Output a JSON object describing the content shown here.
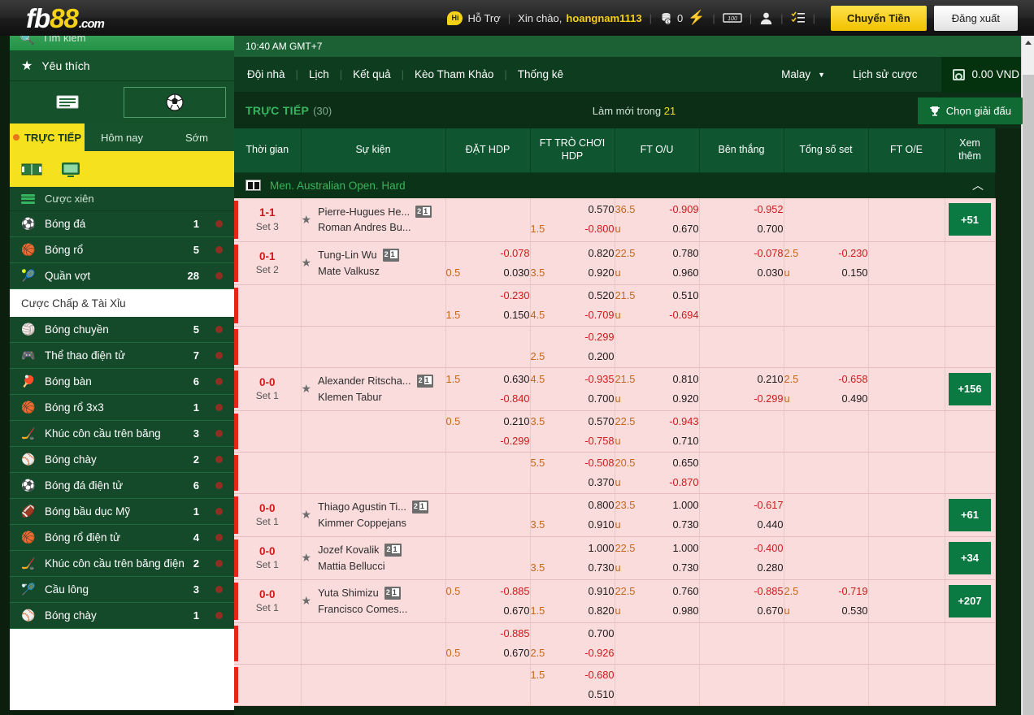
{
  "header": {
    "logo_fb": "fb",
    "logo_88": "88",
    "logo_dotcom": ".com",
    "hi_label": "Hi",
    "support_label": "Hỗ Trợ",
    "greeting": "Xin chào,",
    "username": "hoangnam1113",
    "coin_count": "0",
    "transfer_button": "Chuyển Tiền",
    "logout_button": "Đăng xuất",
    "icons": [
      "chat-bubble-icon",
      "coin-stack-icon",
      "lightning-icon",
      "cash-icon",
      "user-icon",
      "checklist-icon"
    ]
  },
  "sidebar": {
    "search_placeholder": "Tìm kiếm",
    "favourites_label": "Yêu thích",
    "mode_icons": [
      "ticket-icon",
      "football-icon"
    ],
    "tabs": [
      {
        "label": "TRỰC TIẾP",
        "active": true
      },
      {
        "label": "Hôm nay",
        "active": false
      },
      {
        "label": "Sớm",
        "active": false
      }
    ],
    "view_icons": [
      "field-view-icon",
      "tv-view-icon"
    ],
    "parlay_label": "Cược xiên",
    "sports": [
      {
        "icon": "soccer-icon",
        "name": "Bóng đá",
        "count": "1"
      },
      {
        "icon": "basketball-icon",
        "name": "Bóng rổ",
        "count": "5"
      },
      {
        "icon": "tennis-icon",
        "name": "Quần vợt",
        "count": "28"
      }
    ],
    "submenu_label": "Cược Chấp & Tài Xỉu",
    "sports2": [
      {
        "icon": "volleyball-icon",
        "name": "Bóng chuyền",
        "count": "5"
      },
      {
        "icon": "gamepad-icon",
        "name": "Thể thao điện tử",
        "count": "7"
      },
      {
        "icon": "pingpong-icon",
        "name": "Bóng bàn",
        "count": "6"
      },
      {
        "icon": "basketball3x3-icon",
        "name": "Bóng rổ 3x3",
        "count": "1"
      },
      {
        "icon": "hockey-icon",
        "name": "Khúc côn cầu trên băng",
        "count": "3"
      },
      {
        "icon": "baseball-icon",
        "name": "Bóng chày",
        "count": "2"
      },
      {
        "icon": "esoccer-icon",
        "name": "Bóng đá điện tử",
        "count": "6"
      },
      {
        "icon": "football-us-icon",
        "name": "Bóng bầu dục Mỹ",
        "count": "1"
      },
      {
        "icon": "ebasketball-icon",
        "name": "Bóng rổ điện tử",
        "count": "4"
      },
      {
        "icon": "ehockey-icon",
        "name": "Khúc côn cầu trên băng điện tử",
        "count": "2"
      },
      {
        "icon": "badminton-icon",
        "name": "Cầu lông",
        "count": "3"
      },
      {
        "icon": "ebaseball-icon",
        "name": "Bóng chày",
        "count": "1"
      }
    ]
  },
  "main": {
    "clock": "10:40 AM GMT+7",
    "nav": [
      "Đội nhà",
      "Lịch",
      "Kết quả",
      "Kèo Tham Khảo",
      "Thống kê"
    ],
    "odds_format": "Malay",
    "bet_history": "Lịch sử cược",
    "balance": "0.00 VND",
    "live_title": "TRỰC TIẾP",
    "live_count": "(30)",
    "refresh_prefix": "Làm mới trong",
    "refresh_seconds": "21",
    "league_button": "Chọn giải đấu",
    "columns": [
      "Thời gian",
      "Sự kiện",
      "ĐẶT HDP",
      "FT TRÒ CHƠI HDP",
      "FT O/U",
      "Bên thắng",
      "Tổng số set",
      "FT O/E",
      "Xem thêm"
    ],
    "league": "Men. Australian Open. Hard",
    "rows": [
      {
        "score": "1-1",
        "set": "Set 3",
        "team1": "Pierre-Hugues He...",
        "team2": "Roman Andres Bu...",
        "badge": "21",
        "hdp": {
          "l1h": "",
          "l1v": "",
          "l1n": false,
          "l2h": "",
          "l2v": "",
          "l2n": false
        },
        "ftg": {
          "l1h": "",
          "l1v": "0.570",
          "l1n": false,
          "l2h": "1.5",
          "l2v": "-0.800",
          "l2n": true
        },
        "ou": {
          "l1h": "36.5",
          "l1v": "-0.909",
          "l1n": true,
          "l2h": "u",
          "l2v": "0.670",
          "l2n": false
        },
        "win": {
          "l1h": "",
          "l1v": "-0.952",
          "l1n": true,
          "l2h": "",
          "l2v": "0.700",
          "l2n": false
        },
        "sets": {
          "l1h": "",
          "l1v": "",
          "l1n": false,
          "l2h": "",
          "l2v": "",
          "l2n": false
        },
        "oe": {
          "l1h": "",
          "l1v": "",
          "l1n": false,
          "l2h": "",
          "l2v": "",
          "l2n": false
        },
        "more": "+51"
      },
      {
        "score": "0-1",
        "set": "Set 2",
        "team1": "Tung-Lin Wu",
        "team2": "Mate Valkusz",
        "badge": "21",
        "hdp": {
          "l1h": "",
          "l1v": "-0.078",
          "l1n": true,
          "l2h": "0.5",
          "l2v": "0.030",
          "l2n": false
        },
        "ftg": {
          "l1h": "",
          "l1v": "0.820",
          "l1n": false,
          "l2h": "3.5",
          "l2v": "0.920",
          "l2n": false
        },
        "ou": {
          "l1h": "22.5",
          "l1v": "0.780",
          "l1n": false,
          "l2h": "u",
          "l2v": "0.960",
          "l2n": false
        },
        "win": {
          "l1h": "",
          "l1v": "-0.078",
          "l1n": true,
          "l2h": "",
          "l2v": "0.030",
          "l2n": false
        },
        "sets": {
          "l1h": "2.5",
          "l1v": "-0.230",
          "l1n": true,
          "l2h": "u",
          "l2v": "0.150",
          "l2n": false
        },
        "oe": {
          "l1h": "",
          "l1v": "",
          "l1n": false,
          "l2h": "",
          "l2v": "",
          "l2n": false
        },
        "more": ""
      },
      {
        "score": "",
        "set": "",
        "team1": "",
        "team2": "",
        "badge": "",
        "hdp": {
          "l1h": "",
          "l1v": "-0.230",
          "l1n": true,
          "l2h": "1.5",
          "l2v": "0.150",
          "l2n": false
        },
        "ftg": {
          "l1h": "",
          "l1v": "0.520",
          "l1n": false,
          "l2h": "4.5",
          "l2v": "-0.709",
          "l2n": true
        },
        "ou": {
          "l1h": "21.5",
          "l1v": "0.510",
          "l1n": false,
          "l2h": "u",
          "l2v": "-0.694",
          "l2n": true
        },
        "win": {
          "l1h": "",
          "l1v": "",
          "l1n": false,
          "l2h": "",
          "l2v": "",
          "l2n": false
        },
        "sets": {
          "l1h": "",
          "l1v": "",
          "l1n": false,
          "l2h": "",
          "l2v": "",
          "l2n": false
        },
        "oe": {
          "l1h": "",
          "l1v": "",
          "l1n": false,
          "l2h": "",
          "l2v": "",
          "l2n": false
        },
        "more": ""
      },
      {
        "score": "",
        "set": "",
        "team1": "",
        "team2": "",
        "badge": "",
        "hdp": {
          "l1h": "",
          "l1v": "",
          "l1n": false,
          "l2h": "",
          "l2v": "",
          "l2n": false
        },
        "ftg": {
          "l1h": "",
          "l1v": "-0.299",
          "l1n": true,
          "l2h": "2.5",
          "l2v": "0.200",
          "l2n": false
        },
        "ou": {
          "l1h": "",
          "l1v": "",
          "l1n": false,
          "l2h": "",
          "l2v": "",
          "l2n": false
        },
        "win": {
          "l1h": "",
          "l1v": "",
          "l1n": false,
          "l2h": "",
          "l2v": "",
          "l2n": false
        },
        "sets": {
          "l1h": "",
          "l1v": "",
          "l1n": false,
          "l2h": "",
          "l2v": "",
          "l2n": false
        },
        "oe": {
          "l1h": "",
          "l1v": "",
          "l1n": false,
          "l2h": "",
          "l2v": "",
          "l2n": false
        },
        "more": ""
      },
      {
        "score": "0-0",
        "set": "Set 1",
        "team1": "Alexander Ritscha...",
        "team2": "Klemen Tabur",
        "badge": "21",
        "hdp": {
          "l1h": "1.5",
          "l1v": "0.630",
          "l1n": false,
          "l2h": "",
          "l2v": "-0.840",
          "l2n": true
        },
        "ftg": {
          "l1h": "4.5",
          "l1v": "-0.935",
          "l1n": true,
          "l2h": "",
          "l2v": "0.700",
          "l2n": false
        },
        "ou": {
          "l1h": "21.5",
          "l1v": "0.810",
          "l1n": false,
          "l2h": "u",
          "l2v": "0.920",
          "l2n": false
        },
        "win": {
          "l1h": "",
          "l1v": "0.210",
          "l1n": false,
          "l2h": "",
          "l2v": "-0.299",
          "l2n": true
        },
        "sets": {
          "l1h": "2.5",
          "l1v": "-0.658",
          "l1n": true,
          "l2h": "u",
          "l2v": "0.490",
          "l2n": false
        },
        "oe": {
          "l1h": "",
          "l1v": "",
          "l1n": false,
          "l2h": "",
          "l2v": "",
          "l2n": false
        },
        "more": "+156"
      },
      {
        "score": "",
        "set": "",
        "team1": "",
        "team2": "",
        "badge": "",
        "hdp": {
          "l1h": "0.5",
          "l1v": "0.210",
          "l1n": false,
          "l2h": "",
          "l2v": "-0.299",
          "l2n": true
        },
        "ftg": {
          "l1h": "3.5",
          "l1v": "0.570",
          "l1n": false,
          "l2h": "",
          "l2v": "-0.758",
          "l2n": true
        },
        "ou": {
          "l1h": "22.5",
          "l1v": "-0.943",
          "l1n": true,
          "l2h": "u",
          "l2v": "0.710",
          "l2n": false
        },
        "win": {
          "l1h": "",
          "l1v": "",
          "l1n": false,
          "l2h": "",
          "l2v": "",
          "l2n": false
        },
        "sets": {
          "l1h": "",
          "l1v": "",
          "l1n": false,
          "l2h": "",
          "l2v": "",
          "l2n": false
        },
        "oe": {
          "l1h": "",
          "l1v": "",
          "l1n": false,
          "l2h": "",
          "l2v": "",
          "l2n": false
        },
        "more": ""
      },
      {
        "score": "",
        "set": "",
        "team1": "",
        "team2": "",
        "badge": "",
        "hdp": {
          "l1h": "",
          "l1v": "",
          "l1n": false,
          "l2h": "",
          "l2v": "",
          "l2n": false
        },
        "ftg": {
          "l1h": "5.5",
          "l1v": "-0.508",
          "l1n": true,
          "l2h": "",
          "l2v": "0.370",
          "l2n": false
        },
        "ou": {
          "l1h": "20.5",
          "l1v": "0.650",
          "l1n": false,
          "l2h": "u",
          "l2v": "-0.870",
          "l2n": true
        },
        "win": {
          "l1h": "",
          "l1v": "",
          "l1n": false,
          "l2h": "",
          "l2v": "",
          "l2n": false
        },
        "sets": {
          "l1h": "",
          "l1v": "",
          "l1n": false,
          "l2h": "",
          "l2v": "",
          "l2n": false
        },
        "oe": {
          "l1h": "",
          "l1v": "",
          "l1n": false,
          "l2h": "",
          "l2v": "",
          "l2n": false
        },
        "more": ""
      },
      {
        "score": "0-0",
        "set": "Set 1",
        "team1": "Thiago Agustin Ti...",
        "team2": "Kimmer Coppejans",
        "badge": "21",
        "hdp": {
          "l1h": "",
          "l1v": "",
          "l1n": false,
          "l2h": "",
          "l2v": "",
          "l2n": false
        },
        "ftg": {
          "l1h": "",
          "l1v": "0.800",
          "l1n": false,
          "l2h": "3.5",
          "l2v": "0.910",
          "l2n": false
        },
        "ou": {
          "l1h": "23.5",
          "l1v": "1.000",
          "l1n": false,
          "l2h": "u",
          "l2v": "0.730",
          "l2n": false
        },
        "win": {
          "l1h": "",
          "l1v": "-0.617",
          "l1n": true,
          "l2h": "",
          "l2v": "0.440",
          "l2n": false
        },
        "sets": {
          "l1h": "",
          "l1v": "",
          "l1n": false,
          "l2h": "",
          "l2v": "",
          "l2n": false
        },
        "oe": {
          "l1h": "",
          "l1v": "",
          "l1n": false,
          "l2h": "",
          "l2v": "",
          "l2n": false
        },
        "more": "+61"
      },
      {
        "score": "0-0",
        "set": "Set 1",
        "team1": "Jozef Kovalik",
        "team2": "Mattia Bellucci",
        "badge": "21",
        "hdp": {
          "l1h": "",
          "l1v": "",
          "l1n": false,
          "l2h": "",
          "l2v": "",
          "l2n": false
        },
        "ftg": {
          "l1h": "",
          "l1v": "1.000",
          "l1n": false,
          "l2h": "3.5",
          "l2v": "0.730",
          "l2n": false
        },
        "ou": {
          "l1h": "22.5",
          "l1v": "1.000",
          "l1n": false,
          "l2h": "u",
          "l2v": "0.730",
          "l2n": false
        },
        "win": {
          "l1h": "",
          "l1v": "-0.400",
          "l1n": true,
          "l2h": "",
          "l2v": "0.280",
          "l2n": false
        },
        "sets": {
          "l1h": "",
          "l1v": "",
          "l1n": false,
          "l2h": "",
          "l2v": "",
          "l2n": false
        },
        "oe": {
          "l1h": "",
          "l1v": "",
          "l1n": false,
          "l2h": "",
          "l2v": "",
          "l2n": false
        },
        "more": "+34"
      },
      {
        "score": "0-0",
        "set": "Set 1",
        "team1": "Yuta Shimizu",
        "team2": "Francisco Comes...",
        "badge": "21",
        "hdp": {
          "l1h": "0.5",
          "l1v": "-0.885",
          "l1n": true,
          "l2h": "",
          "l2v": "0.670",
          "l2n": false
        },
        "ftg": {
          "l1h": "",
          "l1v": "0.910",
          "l1n": false,
          "l2h": "1.5",
          "l2v": "0.820",
          "l2n": false
        },
        "ou": {
          "l1h": "22.5",
          "l1v": "0.760",
          "l1n": false,
          "l2h": "u",
          "l2v": "0.980",
          "l2n": false
        },
        "win": {
          "l1h": "",
          "l1v": "-0.885",
          "l1n": true,
          "l2h": "",
          "l2v": "0.670",
          "l2n": false
        },
        "sets": {
          "l1h": "2.5",
          "l1v": "-0.719",
          "l1n": true,
          "l2h": "u",
          "l2v": "0.530",
          "l2n": false
        },
        "oe": {
          "l1h": "",
          "l1v": "",
          "l1n": false,
          "l2h": "",
          "l2v": "",
          "l2n": false
        },
        "more": "+207"
      },
      {
        "score": "",
        "set": "",
        "team1": "",
        "team2": "",
        "badge": "",
        "hdp": {
          "l1h": "",
          "l1v": "-0.885",
          "l1n": true,
          "l2h": "0.5",
          "l2v": "0.670",
          "l2n": false
        },
        "ftg": {
          "l1h": "",
          "l1v": "0.700",
          "l1n": false,
          "l2h": "2.5",
          "l2v": "-0.926",
          "l2n": true
        },
        "ou": {
          "l1h": "",
          "l1v": "",
          "l1n": false,
          "l2h": "",
          "l2v": "",
          "l2n": false
        },
        "win": {
          "l1h": "",
          "l1v": "",
          "l1n": false,
          "l2h": "",
          "l2v": "",
          "l2n": false
        },
        "sets": {
          "l1h": "",
          "l1v": "",
          "l1n": false,
          "l2h": "",
          "l2v": "",
          "l2n": false
        },
        "oe": {
          "l1h": "",
          "l1v": "",
          "l1n": false,
          "l2h": "",
          "l2v": "",
          "l2n": false
        },
        "more": ""
      },
      {
        "score": "",
        "set": "",
        "team1": "",
        "team2": "",
        "badge": "",
        "hdp": {
          "l1h": "",
          "l1v": "",
          "l1n": false,
          "l2h": "",
          "l2v": "",
          "l2n": false
        },
        "ftg": {
          "l1h": "1.5",
          "l1v": "-0.680",
          "l1n": true,
          "l2h": "",
          "l2v": "0.510",
          "l2n": false
        },
        "ou": {
          "l1h": "",
          "l1v": "",
          "l1n": false,
          "l2h": "",
          "l2v": "",
          "l2n": false
        },
        "win": {
          "l1h": "",
          "l1v": "",
          "l1n": false,
          "l2h": "",
          "l2v": "",
          "l2n": false
        },
        "sets": {
          "l1h": "",
          "l1v": "",
          "l1n": false,
          "l2h": "",
          "l2v": "",
          "l2n": false
        },
        "oe": {
          "l1h": "",
          "l1v": "",
          "l1n": false,
          "l2h": "",
          "l2v": "",
          "l2n": false
        },
        "more": ""
      }
    ]
  },
  "colors": {
    "brand_yellow": "#f5d216",
    "green_dark": "#0c2612",
    "green_mid": "#14492a",
    "green_header": "#0e5530",
    "row_pink": "#fbdcdc",
    "negative_red": "#d0191a",
    "hdp_orange": "#c4671a",
    "more_green": "#0b7a42"
  }
}
